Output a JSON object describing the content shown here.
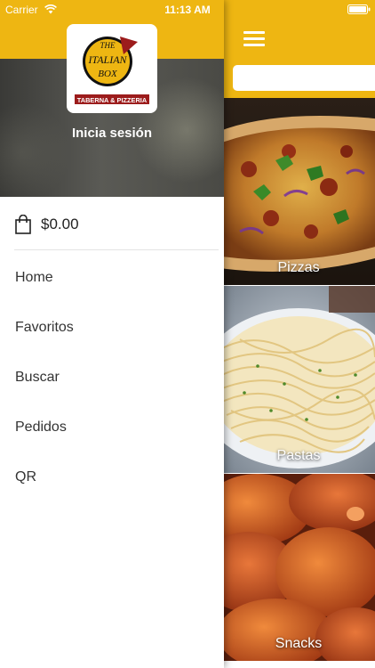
{
  "status_bar": {
    "carrier": "Carrier",
    "time": "11:13 AM",
    "wifi_icon": "wifi-icon",
    "battery_icon": "battery-icon"
  },
  "colors": {
    "brand_yellow": "#EEB612",
    "logo_red": "#9C1C1C"
  },
  "drawer": {
    "logo": {
      "line1": "THE",
      "line2": "ITALIAN",
      "line3": "BOX",
      "banner": "TABERNA & PIZZERIA"
    },
    "login_label": "Inicia sesión",
    "cart": {
      "icon": "shopping-bag-icon",
      "total": "$0.00"
    },
    "menu": [
      {
        "label": "Home"
      },
      {
        "label": "Favoritos"
      },
      {
        "label": "Buscar"
      },
      {
        "label": "Pedidos"
      },
      {
        "label": "QR"
      }
    ]
  },
  "main": {
    "menu_icon": "hamburger-icon",
    "search": {
      "placeholder": "",
      "value": ""
    },
    "categories": [
      {
        "label": "Pizzas"
      },
      {
        "label": "Pastas"
      },
      {
        "label": "Snacks"
      }
    ]
  }
}
